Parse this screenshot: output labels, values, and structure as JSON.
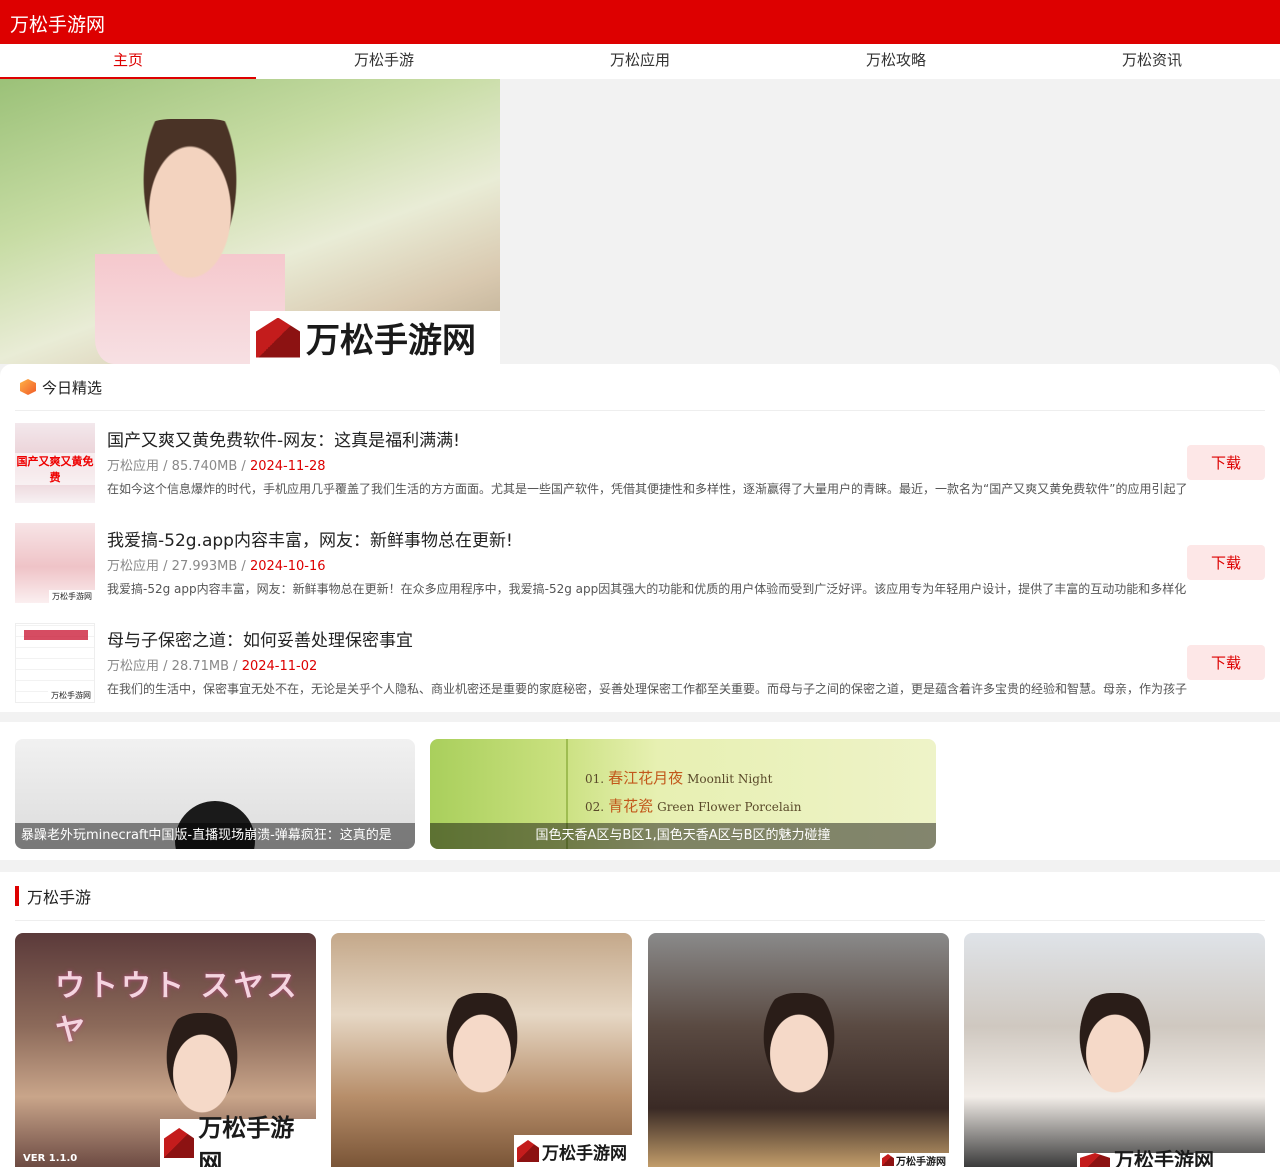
{
  "header": {
    "site_title": "万松手游网"
  },
  "nav": {
    "items": [
      "主页",
      "万松手游",
      "万松应用",
      "万松攻略",
      "万松资讯"
    ],
    "active": "主页"
  },
  "banner": {
    "watermark": "万松手游网"
  },
  "featured": {
    "title": "今日精选",
    "icon": "hexagon-icon",
    "items": [
      {
        "title": "国产又爽又黄免费软件-网友：这真是福利满满!",
        "category": "万松应用",
        "size": "85.740MB",
        "date": "2024-11-28",
        "desc": "在如今这个信息爆炸的时代，手机应用几乎覆盖了我们生活的方方面面。尤其是一些国产软件，凭借其便捷性和多样性，逐渐赢得了大量用户的青睐。最近，一款名为“国产又爽又黄免费软件”的应用引起了",
        "thumb_tag": "国产又爽又黄免费",
        "button": "下载"
      },
      {
        "title": "我爱搞-52g.app内容丰富，网友：新鲜事物总在更新!",
        "category": "万松应用",
        "size": "27.993MB",
        "date": "2024-10-16",
        "desc": "我爱搞-52g app内容丰富，网友：新鲜事物总在更新！在众多应用程序中，我爱搞-52g app因其强大的功能和优质的用户体验而受到广泛好评。该应用专为年轻用户设计，提供了丰富的互动功能和多样化",
        "thumb_mark": "万松手游网",
        "button": "下载"
      },
      {
        "title": "母与子保密之道：如何妥善处理保密事宜",
        "category": "万松应用",
        "size": "28.71MB",
        "date": "2024-11-02",
        "desc": "在我们的生活中，保密事宜无处不在，无论是关乎个人隐私、商业机密还是重要的家庭秘密，妥善处理保密工作都至关重要。而母与子之间的保密之道，更是蕴含着许多宝贵的经验和智慧。母亲，作为孩子",
        "thumb_mark": "万松手游网",
        "button": "下载"
      }
    ]
  },
  "promos": [
    {
      "caption": "暴躁老外玩minecraft中国版-直播现场崩溃-弹幕疯狂：这真的是"
    },
    {
      "caption": "国色天香A区与B区1,国色天香A区与B区的魅力碰撞",
      "tracks": [
        {
          "num": "01.",
          "cn": "春江花月夜",
          "en": "Moonlit Night"
        },
        {
          "num": "02.",
          "cn": "青花瓷",
          "en": "Green Flower Porcelain"
        }
      ]
    }
  ],
  "games": {
    "title": "万松手游",
    "cards": [
      {
        "overlay_text": "ウトウト スヤスヤ",
        "ver": "VER 1.1.0",
        "watermark": "万松手游网"
      },
      {
        "watermark": "万松手游网"
      },
      {
        "watermark": "万松手游网"
      },
      {
        "watermark": "万松手游网"
      }
    ]
  }
}
